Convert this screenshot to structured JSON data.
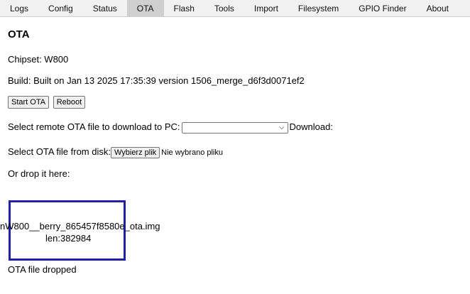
{
  "tabs": [
    {
      "label": "Logs",
      "active": false
    },
    {
      "label": "Config",
      "active": false
    },
    {
      "label": "Status",
      "active": false
    },
    {
      "label": "OTA",
      "active": true
    },
    {
      "label": "Flash",
      "active": false
    },
    {
      "label": "Tools",
      "active": false
    },
    {
      "label": "Import",
      "active": false
    },
    {
      "label": "Filesystem",
      "active": false
    },
    {
      "label": "GPIO Finder",
      "active": false
    },
    {
      "label": "About",
      "active": false
    }
  ],
  "page": {
    "title": "OTA",
    "chipset": "Chipset: W800",
    "build": "Build: Built on Jan 13 2025 17:35:39 version 1506_merge_d6f3d0071ef2",
    "start_ota_label": "Start OTA",
    "reboot_label": "Reboot",
    "remote_select_label": "Select remote OTA file to download to PC:",
    "remote_select_value": "",
    "download_label": "Download:",
    "disk_select_label": "Select OTA file from disk:",
    "choose_file_label": "Wybierz plik",
    "no_file_label": "Nie wybrano pliku",
    "drop_label": "Or drop it here:",
    "dropped_name": "nW800__berry_865457f8580e_ota.img",
    "dropped_len": "len:382984",
    "status": "OTA file dropped"
  },
  "colors": {
    "dropbox_border": "#1f1fa8",
    "tabbar_bg": "#f1f1f1",
    "active_tab_bg": "#cfcfcf"
  }
}
